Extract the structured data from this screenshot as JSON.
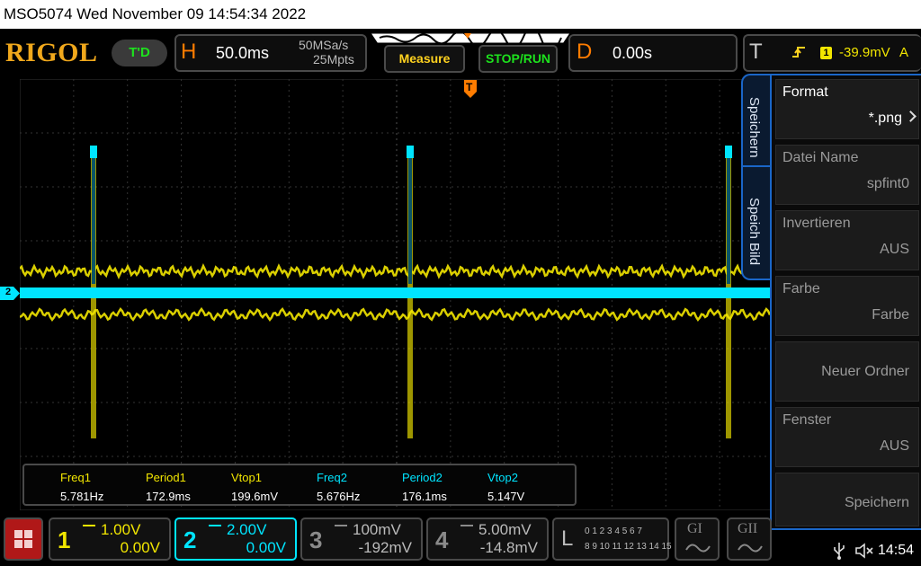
{
  "titlebar": {
    "text": "MSO5074  Wed November 09 14:54:34 2022"
  },
  "header": {
    "logo": "RIGOL",
    "trig_status": "T'D",
    "horizontal": {
      "letter": "H",
      "timebase": "50.0ms",
      "sample_rate": "50MSa/s",
      "memory_depth": "25Mpts"
    },
    "measure_label": "Measure",
    "stoprun_label": "STOP/RUN",
    "delay": {
      "letter": "D",
      "value": "0.00s"
    },
    "trigger": {
      "letter": "T",
      "source": "1",
      "level": "-39.9mV",
      "mode": "A"
    }
  },
  "grid": {
    "trigger_marker": "T",
    "ch2_marker": "2"
  },
  "menu": {
    "tabs": [
      "Speichern",
      "Speich Bild"
    ],
    "items": [
      {
        "label": "Format",
        "value": "*.png"
      },
      {
        "label": "Datei Name",
        "value": "spfint0"
      },
      {
        "label": "Invertieren",
        "value": "AUS"
      },
      {
        "label": "Farbe",
        "value": "Farbe"
      },
      {
        "label": "",
        "value": "Neuer Ordner"
      },
      {
        "label": "Fenster",
        "value": "AUS"
      },
      {
        "label": "",
        "value": "Speichern"
      }
    ]
  },
  "measurements": {
    "headers": [
      "Freq1",
      "Period1",
      "Vtop1",
      "Freq2",
      "Period2",
      "Vtop2"
    ],
    "values": [
      "5.781Hz",
      "172.9ms",
      "199.6mV",
      "5.676Hz",
      "176.1ms",
      "5.147V"
    ]
  },
  "channels": [
    {
      "num": "1",
      "scale": "1.00V",
      "offset": "0.00V",
      "color": "#f2e600"
    },
    {
      "num": "2",
      "scale": "2.00V",
      "offset": "0.00V",
      "color": "#00e5ff"
    },
    {
      "num": "3",
      "scale": "100mV",
      "offset": "-192mV",
      "color": "#8a8a8a"
    },
    {
      "num": "4",
      "scale": "5.00mV",
      "offset": "-14.8mV",
      "color": "#8a8a8a"
    }
  ],
  "logic": {
    "letter": "L",
    "row1": "0 1 2 3  4 5 6 7",
    "row2": "8 9 10 11  12 13 14 15"
  },
  "decode": [
    {
      "label": "GI"
    },
    {
      "label": "GII"
    }
  ],
  "status": {
    "time": "14:54"
  },
  "colors": {
    "ch1": "#f2e600",
    "ch2": "#00e5ff",
    "accent": "#ff7c00",
    "menu_border": "#1a66c8",
    "logo": "#f0a81c"
  },
  "icons": [
    "menu-grid-icon",
    "usb-icon",
    "speaker-muted-icon",
    "trigger-edge-icon"
  ]
}
